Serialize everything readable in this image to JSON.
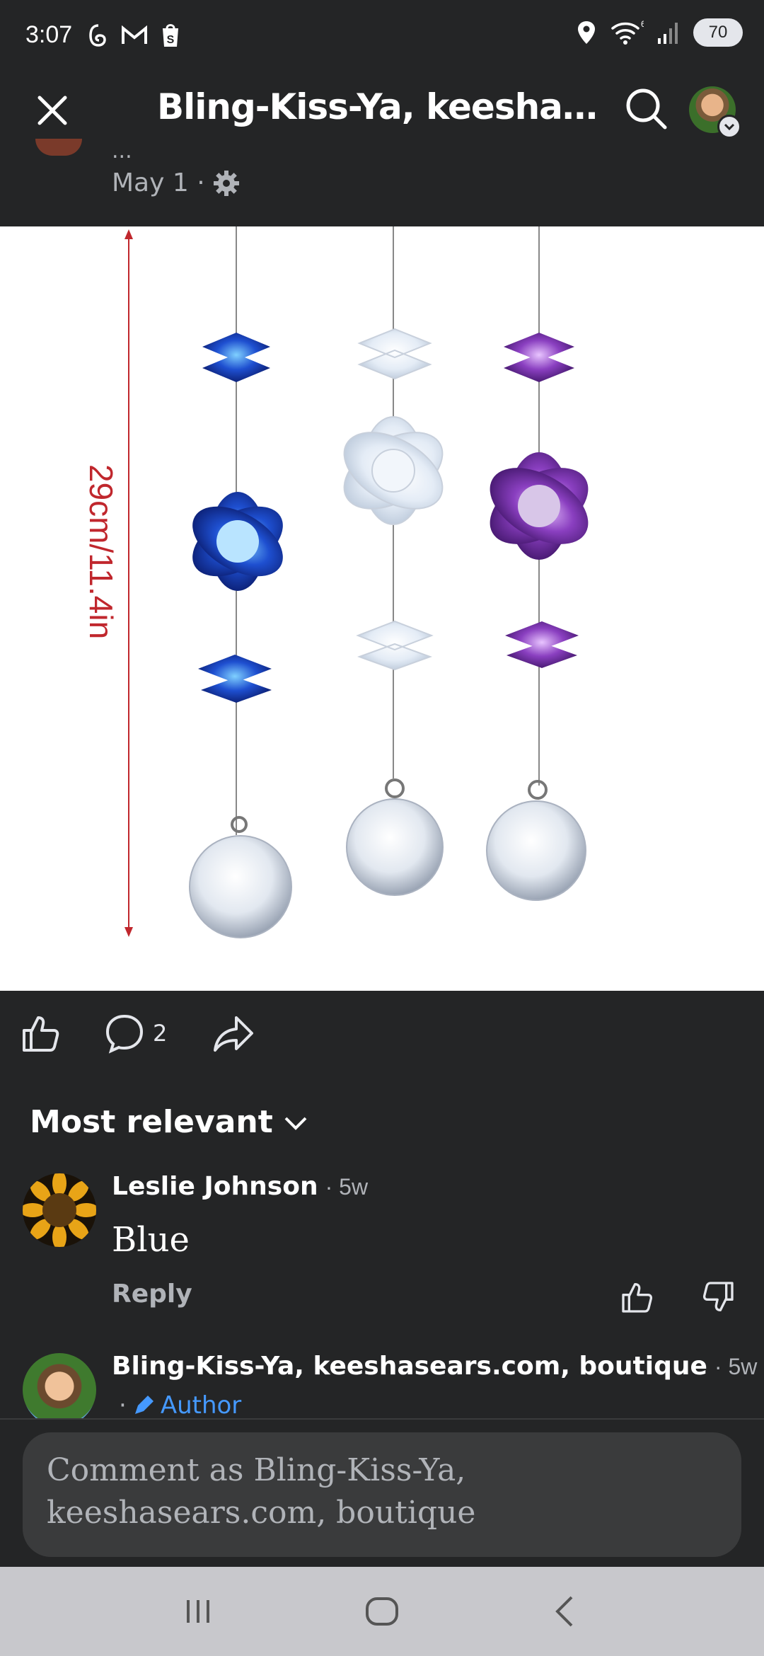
{
  "status_bar": {
    "time": "3:07",
    "battery": "70",
    "left_icons": [
      "threads-icon",
      "gmail-icon",
      "shopify-icon"
    ],
    "right_icons": [
      "location-icon",
      "wifi-icon",
      "signal-icon"
    ]
  },
  "header": {
    "title": "Bling-Kiss-Ya, keeshase..."
  },
  "post": {
    "ellipsis": "...",
    "date": "May 1 ·",
    "image_label": "29cm/11.4in",
    "comment_count": "2"
  },
  "comments_section": {
    "sort_label": "Most relevant",
    "comments": [
      {
        "name": "Leslie Johnson",
        "time": "· 5w",
        "text": "Blue",
        "reply_label": "Reply"
      },
      {
        "name": "Bling-Kiss-Ya, keeshasears.com, boutique",
        "time": "· 5w",
        "badge_prefix": "·",
        "badge": "Author"
      }
    ]
  },
  "composer": {
    "placeholder": "Comment as Bling-Kiss-Ya, keeshasears.com, boutique"
  },
  "colors": {
    "background": "#242526",
    "text": "#e4e6eb",
    "secondary": "#b0b3b8",
    "author_blue": "#4599ff",
    "image_label_red": "#c0272d"
  }
}
